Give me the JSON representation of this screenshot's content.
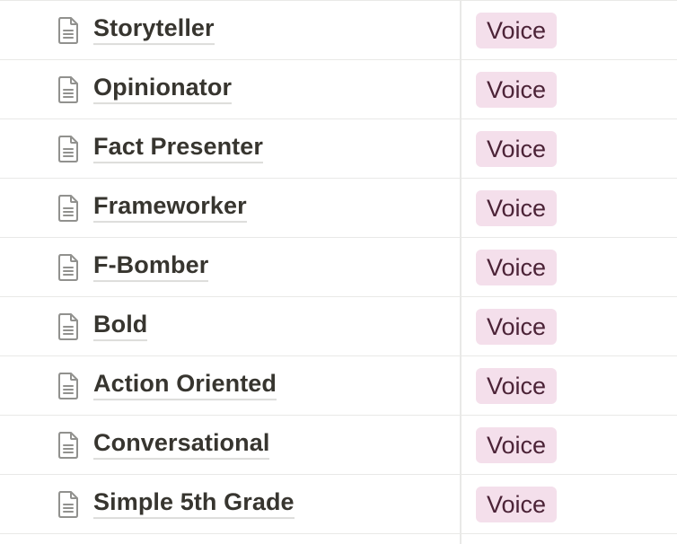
{
  "rows": [
    {
      "name": "Storyteller",
      "tag": "Voice",
      "icon": "document-icon"
    },
    {
      "name": "Opinionator",
      "tag": "Voice",
      "icon": "document-icon"
    },
    {
      "name": "Fact Presenter",
      "tag": "Voice",
      "icon": "document-icon"
    },
    {
      "name": "Frameworker",
      "tag": "Voice",
      "icon": "document-icon"
    },
    {
      "name": "F-Bomber",
      "tag": "Voice",
      "icon": "document-icon"
    },
    {
      "name": "Bold",
      "tag": "Voice",
      "icon": "document-icon"
    },
    {
      "name": "Action Oriented",
      "tag": "Voice",
      "icon": "document-icon"
    },
    {
      "name": "Conversational",
      "tag": "Voice",
      "icon": "document-icon"
    },
    {
      "name": "Simple 5th Grade",
      "tag": "Voice",
      "icon": "document-icon"
    }
  ],
  "colors": {
    "tag_background": "#f4dfeb",
    "tag_text": "#4c2337",
    "text": "#37352f",
    "divider": "#e9e9e7"
  }
}
